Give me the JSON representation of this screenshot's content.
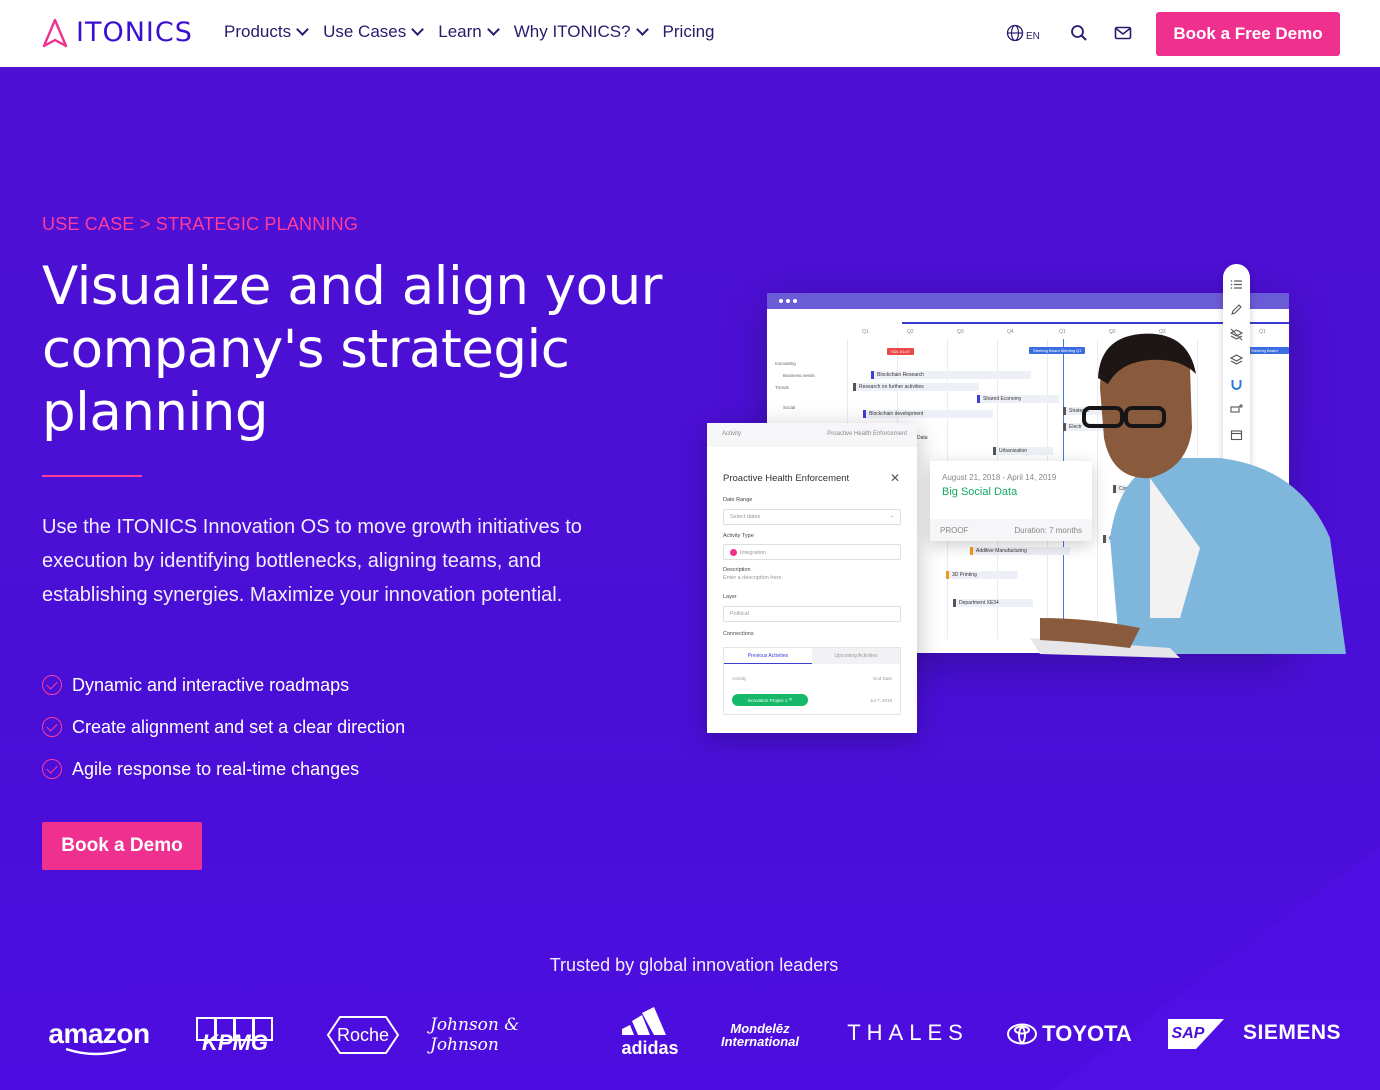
{
  "header": {
    "brand": "ITONICS",
    "nav": [
      {
        "label": "Products",
        "has_dropdown": true
      },
      {
        "label": "Use Cases",
        "has_dropdown": true
      },
      {
        "label": "Learn",
        "has_dropdown": true
      },
      {
        "label": "Why ITONICS?",
        "has_dropdown": true
      },
      {
        "label": "Pricing",
        "has_dropdown": false
      }
    ],
    "lang": "EN",
    "cta": "Book a Free Demo"
  },
  "hero": {
    "breadcrumb": "USE CASE > STRATEGIC PLANNING",
    "title": "Visualize and align your company's strategic planning",
    "lead": "Use the ITONICS Innovation OS to move growth initiatives to execution by identifying bottlenecks, aligning teams, and establishing synergies. Maximize your innovation potential.",
    "features": [
      "Dynamic and interactive roadmaps",
      "Create alignment and set a clear direction",
      "Agile response to real-time changes"
    ],
    "cta": "Book a Demo"
  },
  "mockup": {
    "quarters": [
      "Q1",
      "Q2",
      "Q3",
      "Q4",
      "Q1",
      "Q2",
      "Q3",
      "Q1"
    ],
    "left_rows": [
      "Innovating",
      "Business needs",
      "Trends",
      "Social"
    ],
    "bars": [
      "Blockchain Research",
      "Research on further activities",
      "Shared Economy",
      "Blockchain development",
      "Strategic",
      "Electr",
      "Urbanization",
      "Additive Manufacturing",
      "3D Printing",
      "Department XE34",
      "Connection",
      "Contract"
    ],
    "tags": [
      "SDL #1.#7",
      "Steering Board Meeting Q1",
      "Steering Board Meet"
    ],
    "panel": {
      "top_left": "Activity",
      "top_right": "Proactive Health Enforcement",
      "title": "Proactive Health Enforcement",
      "date_label": "Date Range",
      "date_placeholder": "Select dates",
      "type_label": "Activity Type",
      "type_value": "Integration",
      "desc_label": "Description",
      "desc_placeholder": "Enter a description here.",
      "layer_label": "Layer",
      "layer_value": "Political",
      "connections_label": "Connections",
      "tab_prev": "Previous Activities",
      "tab_next": "Upcoming Activities",
      "col_activity": "Activity",
      "col_end": "End Date",
      "pill": "Innovation Project 1",
      "pill_date": "Jul 7, 2018",
      "data_label": "Data"
    },
    "popup": {
      "dates": "August 21, 2018 - April 14, 2019",
      "title": "Big Social Data",
      "stage": "PROOF",
      "duration": "Duration: 7 months"
    }
  },
  "trusted": {
    "heading": "Trusted by global innovation leaders",
    "logos": [
      "amazon",
      "KPMG",
      "Roche",
      "Johnson & Johnson",
      "adidas",
      "Mondelēz International",
      "THALES",
      "TOYOTA",
      "SAP",
      "SIEMENS"
    ]
  },
  "colors": {
    "accent": "#f0308f",
    "hero_bg": "#4a0fd8",
    "brand": "#3a0fd0"
  }
}
